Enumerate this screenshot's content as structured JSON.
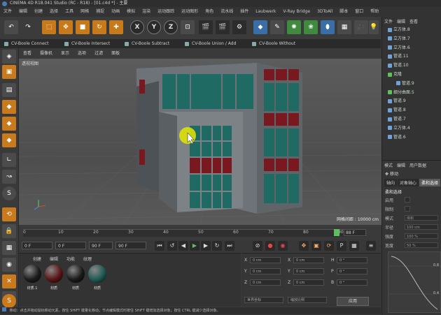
{
  "window": {
    "title": "CINEMA 4D R18.041 Studio (RC - R18) - [01.c4d *] - 主要"
  },
  "menubar": {
    "items": [
      "文件",
      "编辑",
      "创建",
      "选择",
      "工具",
      "网格",
      "捕捉",
      "动画",
      "模拟",
      "渲染",
      "运动跟踪",
      "运动图形",
      "角色",
      "流水线",
      "插件",
      "Laubwerk",
      "V-Ray Bridge",
      "3DToAll",
      "脚本",
      "窗口",
      "帮助"
    ]
  },
  "toolbar": {
    "x_label": "X",
    "y_label": "Y",
    "z_label": "Z"
  },
  "plugin_tabs": [
    "CV-Boole Connect",
    "CV-Boole Intersect",
    "CV-Boole Subtract",
    "CV-Boole Union / Add",
    "CV-Boole Without"
  ],
  "viewport": {
    "menu": [
      "查看",
      "摄像机",
      "显示",
      "选项",
      "过滤",
      "面板"
    ],
    "label": "透视视图",
    "grid_spacing": "网格间距 : 10000 cm"
  },
  "timeline": {
    "ticks": [
      "0",
      "10",
      "20",
      "30",
      "40",
      "50",
      "60",
      "70",
      "80",
      "90"
    ],
    "end_frame": "88 F"
  },
  "playback": {
    "current": "0 F",
    "start": "0 F",
    "preview_end": "90 F",
    "end": "90 F"
  },
  "materials": {
    "menu": [
      "创建",
      "编辑",
      "功能",
      "纹理"
    ],
    "items": [
      {
        "name": "材质.1",
        "color": "#1c1c1c"
      },
      {
        "name": "材质",
        "color": "#5a1416"
      },
      {
        "name": "材质",
        "color": "#1a1a1a"
      },
      {
        "name": "材质",
        "color": "#1f5a55"
      }
    ]
  },
  "coordinates": {
    "rows": [
      {
        "a": "X",
        "av": "0 cm",
        "b": "X",
        "bv": "0 cm",
        "c": "H",
        "cv": "0 °"
      },
      {
        "a": "Y",
        "av": "0 cm",
        "b": "Y",
        "bv": "0 cm",
        "c": "P",
        "cv": "0 °"
      },
      {
        "a": "Z",
        "av": "0 cm",
        "b": "Z",
        "bv": "0 cm",
        "c": "B",
        "cv": "0 °"
      }
    ],
    "mode": "世界坐标",
    "scale_mode": "缩放比例",
    "apply_label": "应用"
  },
  "object_manager": {
    "menu": [
      "文件",
      "编辑",
      "查看"
    ],
    "items": [
      {
        "name": "立方体.8",
        "icon": "cube"
      },
      {
        "name": "立方体.7",
        "icon": "cube"
      },
      {
        "name": "立方体.6",
        "icon": "cube"
      },
      {
        "name": "管道.11",
        "icon": "tube"
      },
      {
        "name": "管道.10",
        "icon": "tube"
      },
      {
        "name": "克隆",
        "icon": "cloner"
      },
      {
        "name": "管道.9",
        "icon": "tube"
      },
      {
        "name": "细分曲面.5",
        "icon": "subdiv"
      },
      {
        "name": "管道.9",
        "icon": "tube"
      },
      {
        "name": "管道.8",
        "icon": "tube"
      },
      {
        "name": "管道.7",
        "icon": "tube"
      },
      {
        "name": "立方体.4",
        "icon": "cube"
      },
      {
        "name": "管道.6",
        "icon": "tube"
      }
    ]
  },
  "attributes": {
    "menu": [
      "模式",
      "编辑",
      "用户数据"
    ],
    "mode": "移动",
    "tabs": [
      "轴向",
      "对象轴心",
      "柔和选择"
    ],
    "section": "柔和选择",
    "fields": [
      {
        "label": "启用"
      },
      {
        "label": "限制"
      },
      {
        "label": "模式",
        "value": "体积"
      },
      {
        "label": "半径",
        "value": "100 cm"
      },
      {
        "label": "强度",
        "value": "100 %"
      },
      {
        "label": "宽度",
        "value": "50 %"
      }
    ],
    "graph_ticks": [
      "0.8",
      "0.4"
    ]
  },
  "statusbar": {
    "text": "移动：点击并拖动鼠标移动元素。按住 SHIFT 键量化移动；节点编辑模式时按住 SHIFT 键增加选择对象；按住 CTRL 键减少选择对象。"
  }
}
